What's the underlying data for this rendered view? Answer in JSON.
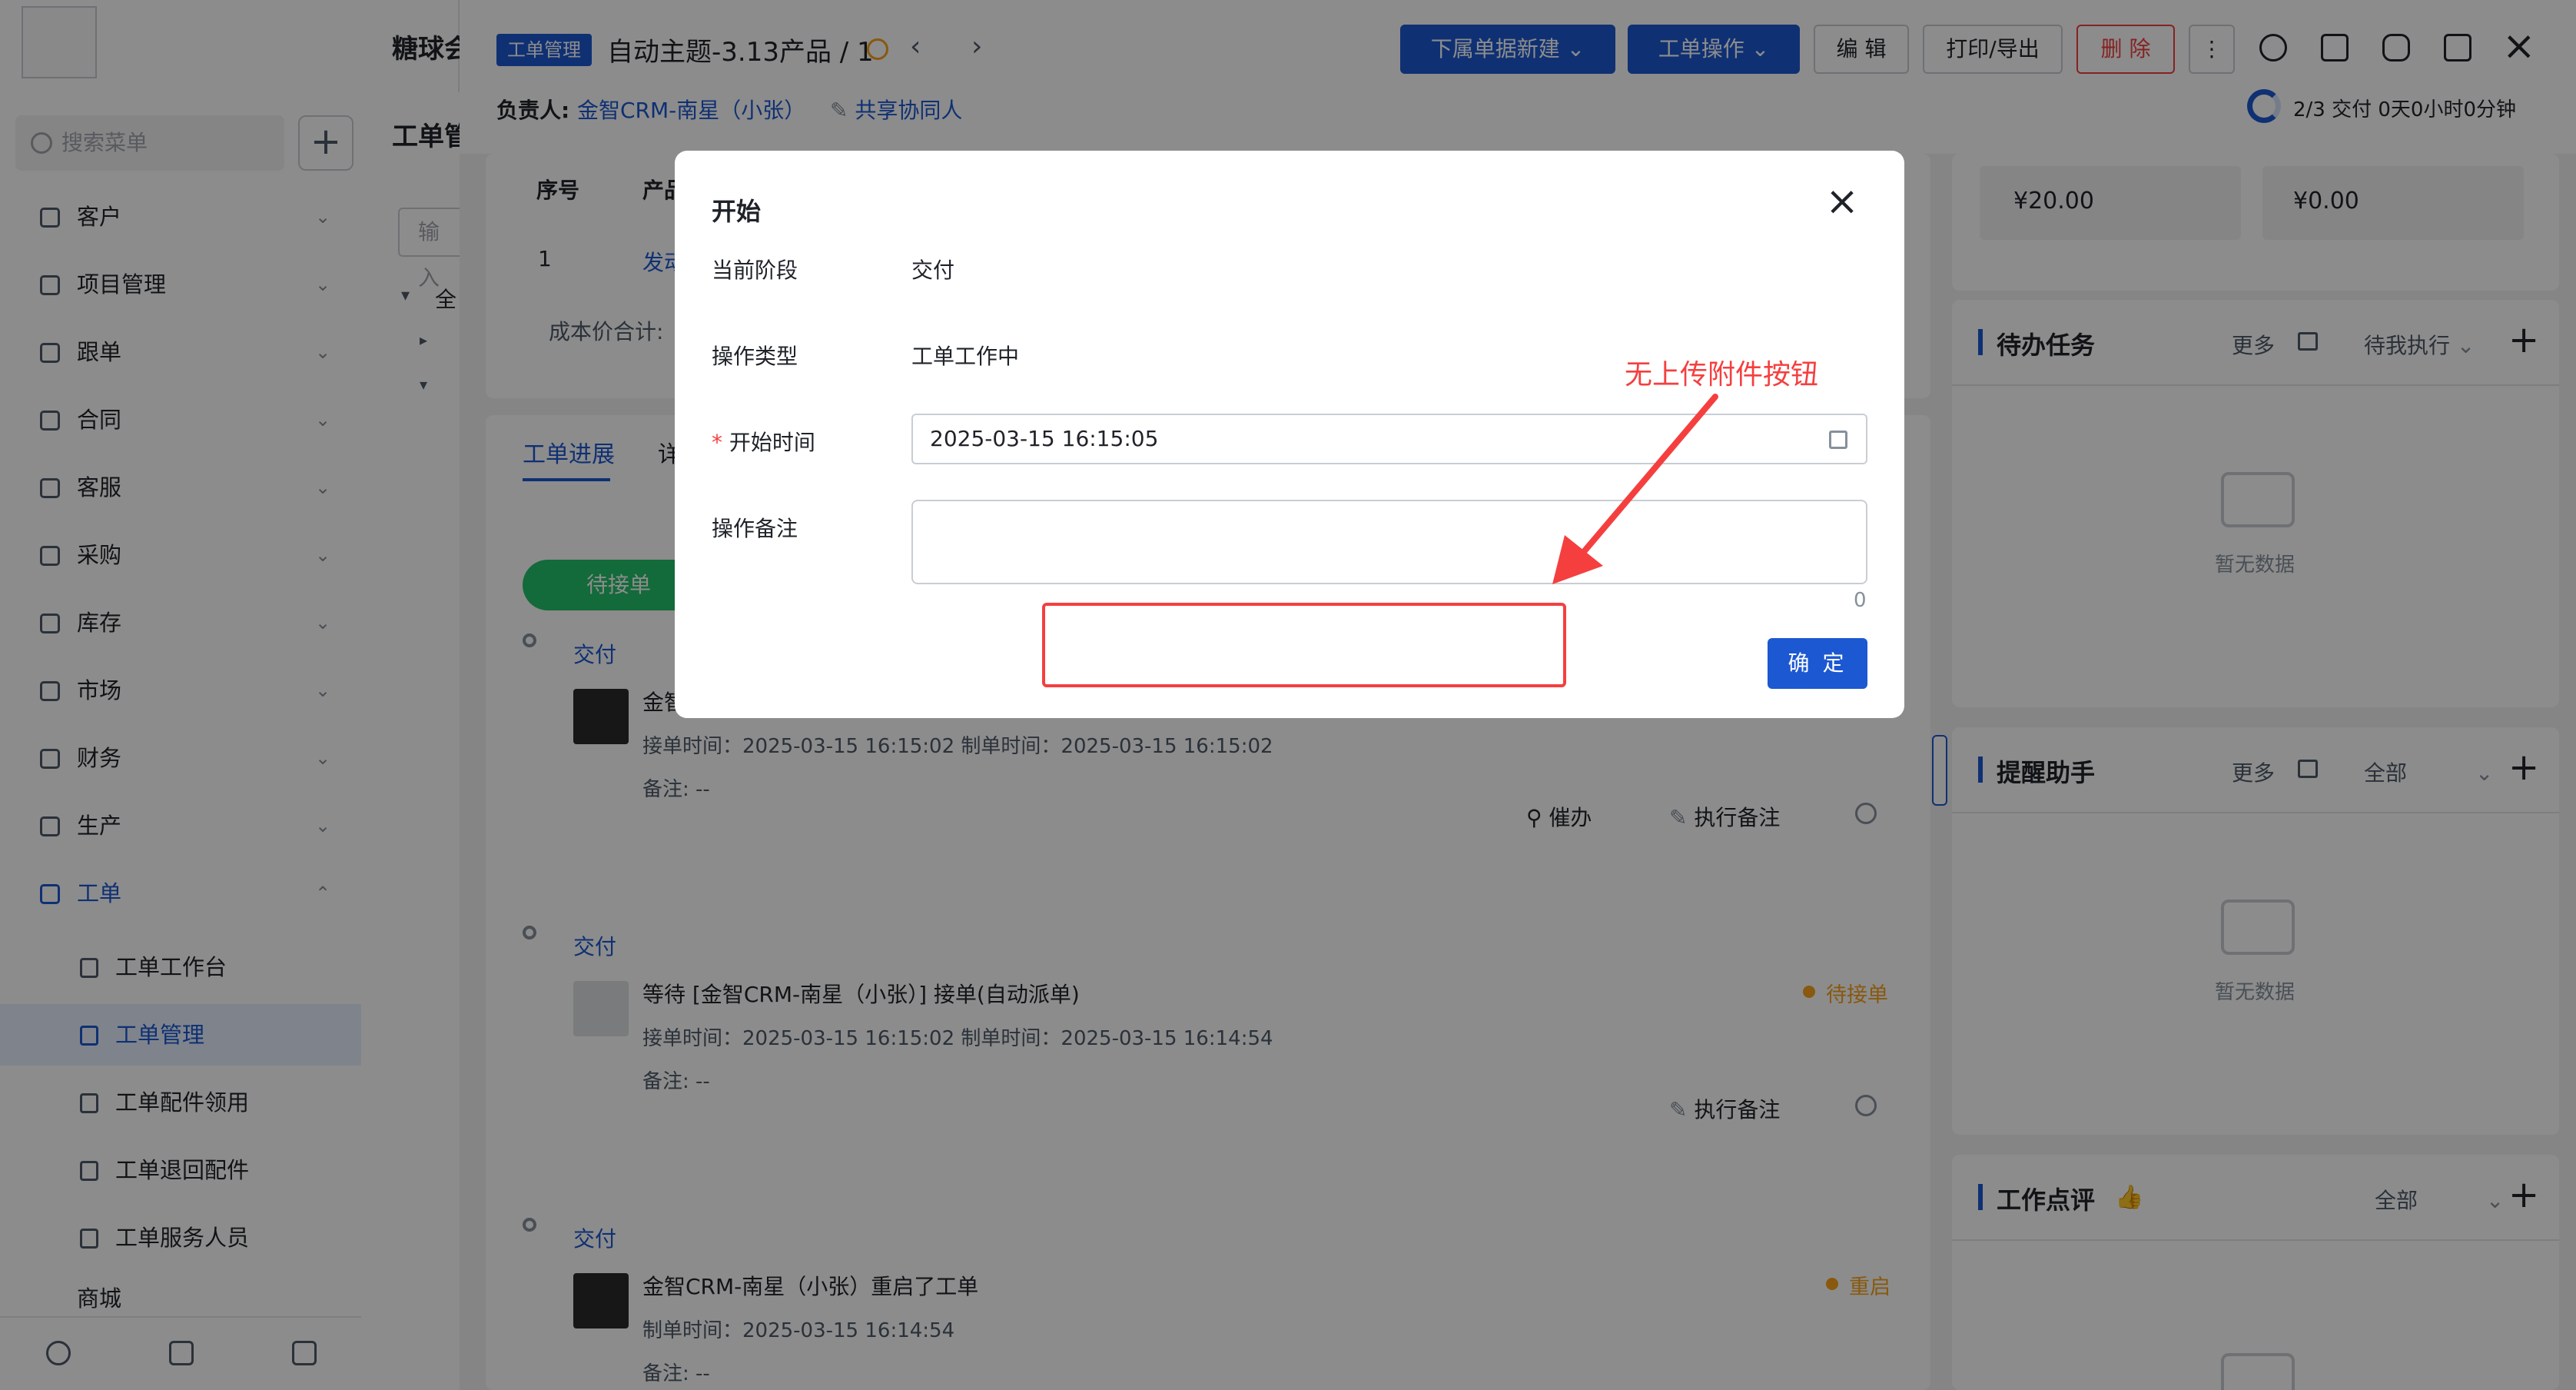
{
  "app": {
    "system_name": "糖球会",
    "menu_search_placeholder": "搜索菜单",
    "column_title": "工单管",
    "column_input_placeholder": "输入"
  },
  "sidebar": {
    "items": [
      {
        "label": "客户",
        "icon": "customer-icon"
      },
      {
        "label": "项目管理",
        "icon": "project-icon"
      },
      {
        "label": "跟单",
        "icon": "follow-icon"
      },
      {
        "label": "合同",
        "icon": "contract-icon"
      },
      {
        "label": "客服",
        "icon": "service-icon"
      },
      {
        "label": "采购",
        "icon": "purchase-icon"
      },
      {
        "label": "库存",
        "icon": "inventory-icon"
      },
      {
        "label": "市场",
        "icon": "market-icon"
      },
      {
        "label": "财务",
        "icon": "finance-icon"
      },
      {
        "label": "生产",
        "icon": "production-icon"
      },
      {
        "label": "工单",
        "icon": "workorder-icon"
      }
    ],
    "subitems": [
      {
        "label": "工单工作台"
      },
      {
        "label": "工单管理"
      },
      {
        "label": "工单配件领用"
      },
      {
        "label": "工单退回配件"
      },
      {
        "label": "工单服务人员"
      }
    ],
    "partial_item": "商城"
  },
  "header": {
    "tag": "工单管理",
    "title": "自动主题-3.13产品 / 1",
    "owner_label": "负责人:",
    "owner_name": "金智CRM-南星（小张）",
    "share_label": "共享协同人",
    "buttons": {
      "sub_new": "下属单据新建",
      "operate": "工单操作",
      "edit": "编 辑",
      "print": "打印/导出",
      "delete": "删 除"
    },
    "progress_fraction": 0.67,
    "progress_text": "2/3",
    "progress_stage": "交付",
    "progress_time": "0天0小时0分钟"
  },
  "table": {
    "headers": [
      "序号",
      "产品"
    ],
    "row": [
      "1",
      "发动"
    ],
    "cost_label": "成本价合计:"
  },
  "tree": {
    "root": "全"
  },
  "tabs": {
    "active": "工单进展",
    "second": "详"
  },
  "timeline": {
    "pill_label": "待接单",
    "entries": [
      {
        "stage": "交付",
        "text": "金智",
        "meta": "接单时间：2025-03-15 16:15:02  制单时间：2025-03-15 16:15:02",
        "remark": "备注:  --",
        "actions": [
          "催办",
          "执行备注"
        ],
        "status": ""
      },
      {
        "stage": "交付",
        "text": "等待 [金智CRM-南星（小张）] 接单(自动派单)",
        "meta": "接单时间：2025-03-15 16:15:02  制单时间：2025-03-15 16:14:54",
        "remark": "备注:  --",
        "actions": [
          "执行备注"
        ],
        "status": "待接单"
      },
      {
        "stage": "交付",
        "text": "金智CRM-南星（小张）重启了工单",
        "meta": "制单时间：2025-03-15 16:14:54",
        "remark": "备注:  --",
        "actions": [],
        "status": "重启"
      }
    ]
  },
  "right": {
    "amount1": "¥20.00",
    "amount2": "¥0.00",
    "todo_title": "待办任务",
    "more": "更多",
    "todo_filter": "待我执行",
    "empty": "暂无数据",
    "remind_title": "提醒助手",
    "remind_filter": "全部",
    "review_title": "工作点评",
    "review_filter": "全部"
  },
  "modal": {
    "title": "开始",
    "stage_label": "当前阶段",
    "stage_value": "交付",
    "type_label": "操作类型",
    "type_value": "工单工作中",
    "required_mark": "*",
    "time_label": "开始时间",
    "time_value": "2025-03-15 16:15:05",
    "remark_label": "操作备注",
    "remark_value": "",
    "char_count": "0",
    "ok": "确 定",
    "annotation": "无上传附件按钮"
  },
  "colors": {
    "primary": "#1c58d1",
    "danger": "#f53f3f",
    "warning": "#f7a21b",
    "success": "#23c26b"
  }
}
